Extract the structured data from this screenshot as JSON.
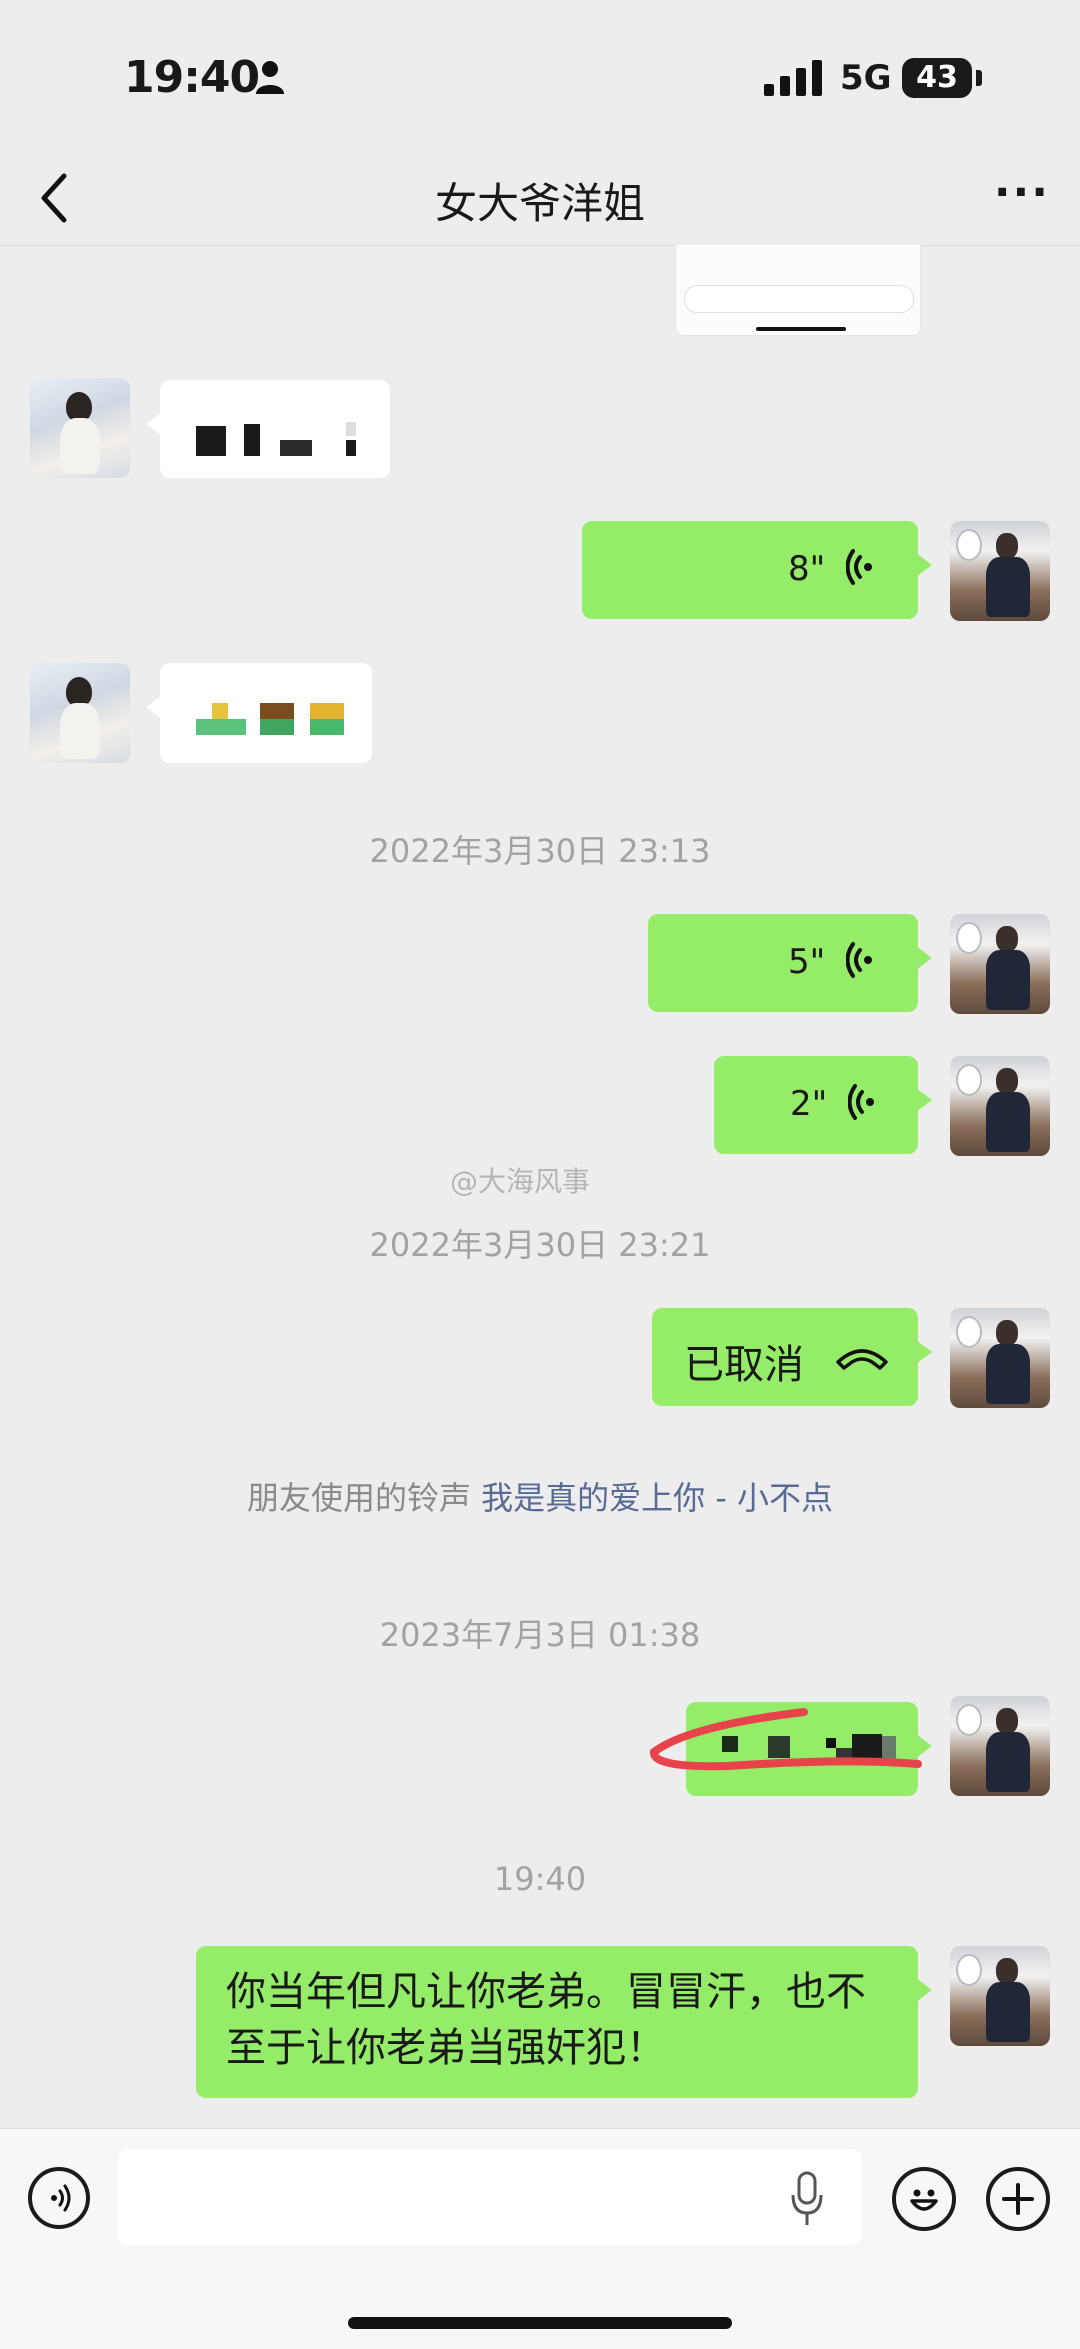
{
  "status_bar": {
    "time": "19:40",
    "network": "5G",
    "battery": "43"
  },
  "nav": {
    "title": "女大爷洋姐",
    "more": "···"
  },
  "messages": {
    "voice1": {
      "duration": "8\""
    },
    "stamp1": "2022年3月30日 23:13",
    "voice2": {
      "duration": "5\""
    },
    "voice3": {
      "duration": "2\""
    },
    "stamp2": "2022年3月30日 23:21",
    "call": {
      "status": "已取消"
    },
    "ringtone": {
      "prefix": "朋友使用的铃声 ",
      "song": "我是真的爱上你 - 小不点"
    },
    "stamp3": "2023年7月3日 01:38",
    "stamp4": "19:40",
    "text1": "你当年但凡让你老弟。冒冒汗，也不至于让你老弟当强奸犯！"
  },
  "watermark": "@大海风事",
  "colors": {
    "outgoing": "#95ec69",
    "incoming": "#ffffff",
    "background": "#ededed",
    "link": "#576b95"
  }
}
